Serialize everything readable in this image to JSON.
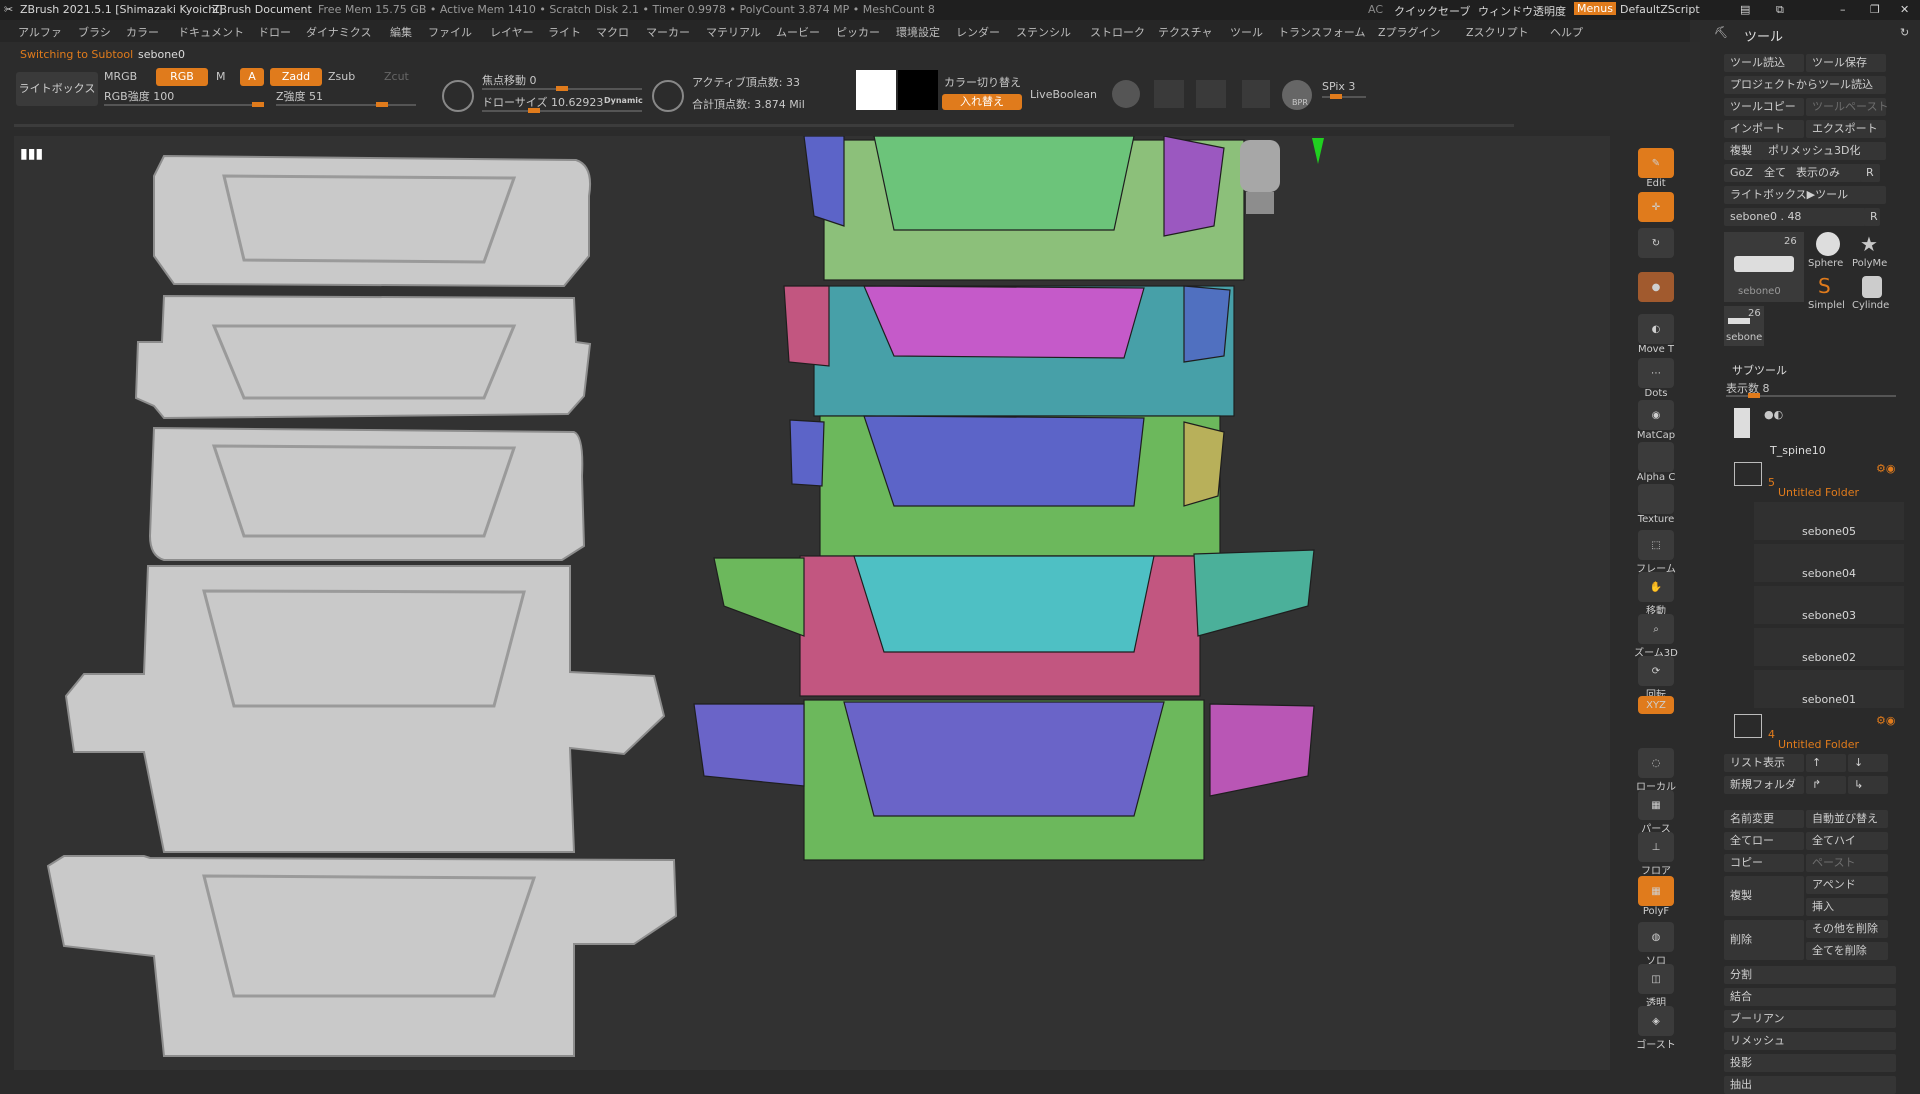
{
  "titlebar": {
    "app": "ZBrush 2021.5.1 [Shimazaki Kyoichi]",
    "doc": "ZBrush Document",
    "mem": "Free Mem 15.75 GB • Active Mem 1410 • Scratch Disk 2.1 • Timer 0.9978 • PolyCount 3.874 MP • MeshCount 8",
    "ac": "AC",
    "quicksave": "クイックセーブ",
    "transparency": "ウィンドウ透明度",
    "menus": "Menus",
    "script": "DefaultZScript"
  },
  "menu": [
    "アルファ",
    "ブラシ",
    "カラー",
    "ドキュメント",
    "ドロー",
    "ダイナミクス",
    "編集",
    "ファイル",
    "レイヤー",
    "ライト",
    "マクロ",
    "マーカー",
    "マテリアル",
    "ムービー",
    "ピッカー",
    "環境設定",
    "レンダー",
    "ステンシル",
    "ストローク",
    "テクスチャ",
    "ツール",
    "トランスフォーム",
    "Zプラグイン",
    "Zスクリプト",
    "ヘルプ"
  ],
  "toolbar": {
    "status_prefix": "Switching to Subtool",
    "status_name": "sebone0",
    "lightbox": "ライトボックス",
    "mrgb": "MRGB",
    "rgb": "RGB",
    "m": "M",
    "a": "A",
    "zadd": "Zadd",
    "zsub": "Zsub",
    "zcut": "Zcut",
    "rgb_intensity": "RGB強度 100",
    "z_intensity": "Z強度 51",
    "focal_shift": "焦点移動 0",
    "draw_size": "ドローサイズ 10.62923",
    "dynamic": "Dynamic",
    "active_points": "アクティブ頂点数: 33",
    "total_points": "合計頂点数: 3.874 Mil",
    "color_switch": "カラー切り替え",
    "swap": "入れ替え",
    "liveboolean": "LiveBoolean",
    "spix": "SPix 3",
    "bpr": "BPR"
  },
  "shelf": {
    "edit": "Edit",
    "move_tool": "Move T",
    "dots": "Dots",
    "matcap": "MatCap",
    "alpha": "Alpha C",
    "texture": "Texture",
    "frame": "フレーム",
    "move": "移動",
    "zoom3d": "ズーム3D",
    "rotate": "回転",
    "xyz": "XYZ",
    "local": "ローカル",
    "perspective": "パース",
    "floor": "フロア",
    "polyf": "PolyF",
    "solo": "ソロ",
    "transp": "透明",
    "ghost": "ゴースト"
  },
  "tool": {
    "header": "ツール",
    "load": "ツール読込",
    "save": "ツール保存",
    "load_from_project": "プロジェクトからツール読込",
    "copy": "ツールコピー",
    "paste": "ツールペースト",
    "import": "インポート",
    "export": "エクスポート",
    "clone": "複製",
    "polymesh3d": "ポリメッシュ3D化",
    "goz": "GoZ",
    "all": "全て",
    "visible": "表示のみ",
    "r": "R",
    "lightbox_tool": "ライトボックス▶ツール",
    "current": "sebone0 . 48",
    "thumb_count": "26",
    "thumb_name": "sebone0",
    "sphere": "Sphere",
    "polymesh": "PolyMe",
    "simple": "Simplel",
    "cylinder": "Cylinde",
    "small_count": "26",
    "small_name": "sebone"
  },
  "subtool": {
    "header": "サブツール",
    "visible_count": "表示数 8",
    "items": [
      {
        "name": "T_spine10"
      },
      {
        "name": "Untitled Folder",
        "count": "5",
        "folder": true
      },
      {
        "name": "sebone05"
      },
      {
        "name": "sebone04"
      },
      {
        "name": "sebone03"
      },
      {
        "name": "sebone02"
      },
      {
        "name": "sebone01"
      },
      {
        "name": "Untitled Folder",
        "count": "4",
        "folder": true
      }
    ],
    "list_view": "リスト表示",
    "new_folder": "新規フォルダ",
    "rename": "名前変更",
    "auto_reorder": "自動並び替え",
    "all_low": "全てロー",
    "all_high": "全てハイ",
    "copy": "コピー",
    "paste": "ペースト",
    "duplicate": "複製",
    "append": "アペンド",
    "insert": "挿入",
    "delete": "削除",
    "delete_other": "その他を削除",
    "delete_all": "全てを削除",
    "split": "分割",
    "merge": "結合",
    "boolean": "ブーリアン",
    "remesh": "リメッシュ",
    "project": "投影",
    "extract": "抽出"
  },
  "colors": {
    "accent": "#e07b1c",
    "group_green": "#6cc47a",
    "group_magenta": "#b956b5",
    "group_blue": "#5c64c8",
    "group_cyan": "#4ec0c4",
    "group_pink": "#c25680"
  }
}
